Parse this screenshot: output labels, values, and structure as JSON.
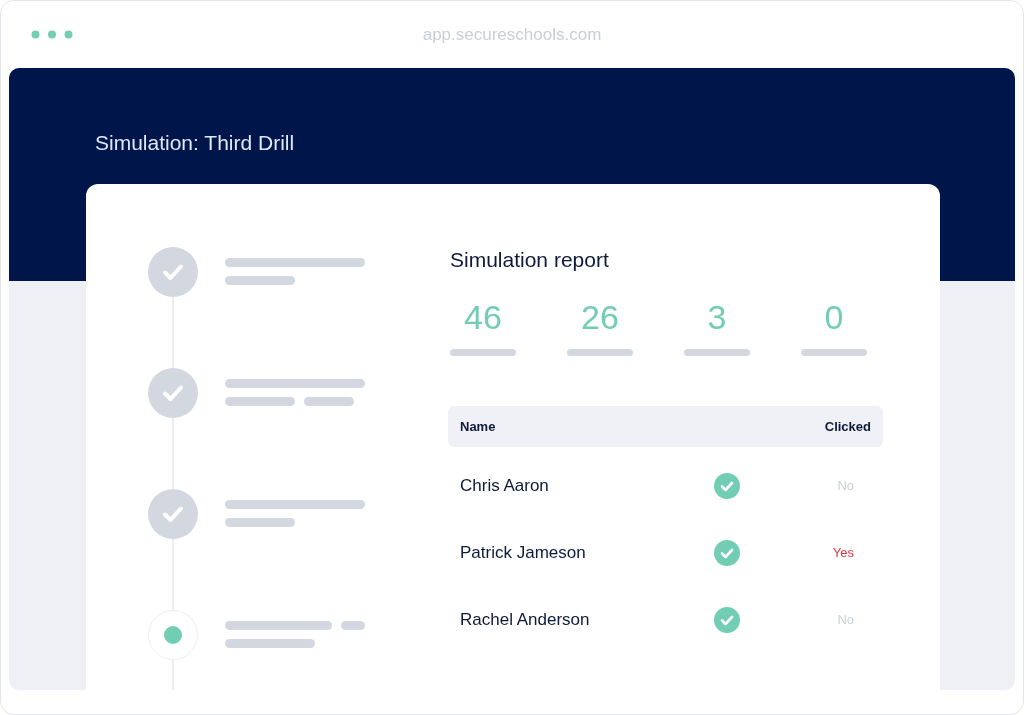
{
  "browser": {
    "url": "app.secureschools.com"
  },
  "page_title": "Simulation: Third Drill",
  "steps": [
    {
      "kind": "done"
    },
    {
      "kind": "done"
    },
    {
      "kind": "done"
    },
    {
      "kind": "current"
    }
  ],
  "report": {
    "title": "Simulation report",
    "stats": [
      "46",
      "26",
      "3",
      "0"
    ],
    "table": {
      "columns": [
        "Name",
        "Clicked"
      ],
      "rows": [
        {
          "name": "Chris Aaron",
          "verified": true,
          "clicked": false,
          "clicked_label": "No"
        },
        {
          "name": "Patrick Jameson",
          "verified": true,
          "clicked": true,
          "clicked_label": "Yes"
        },
        {
          "name": "Rachel Anderson",
          "verified": true,
          "clicked": false,
          "clicked_label": "No"
        }
      ]
    }
  }
}
